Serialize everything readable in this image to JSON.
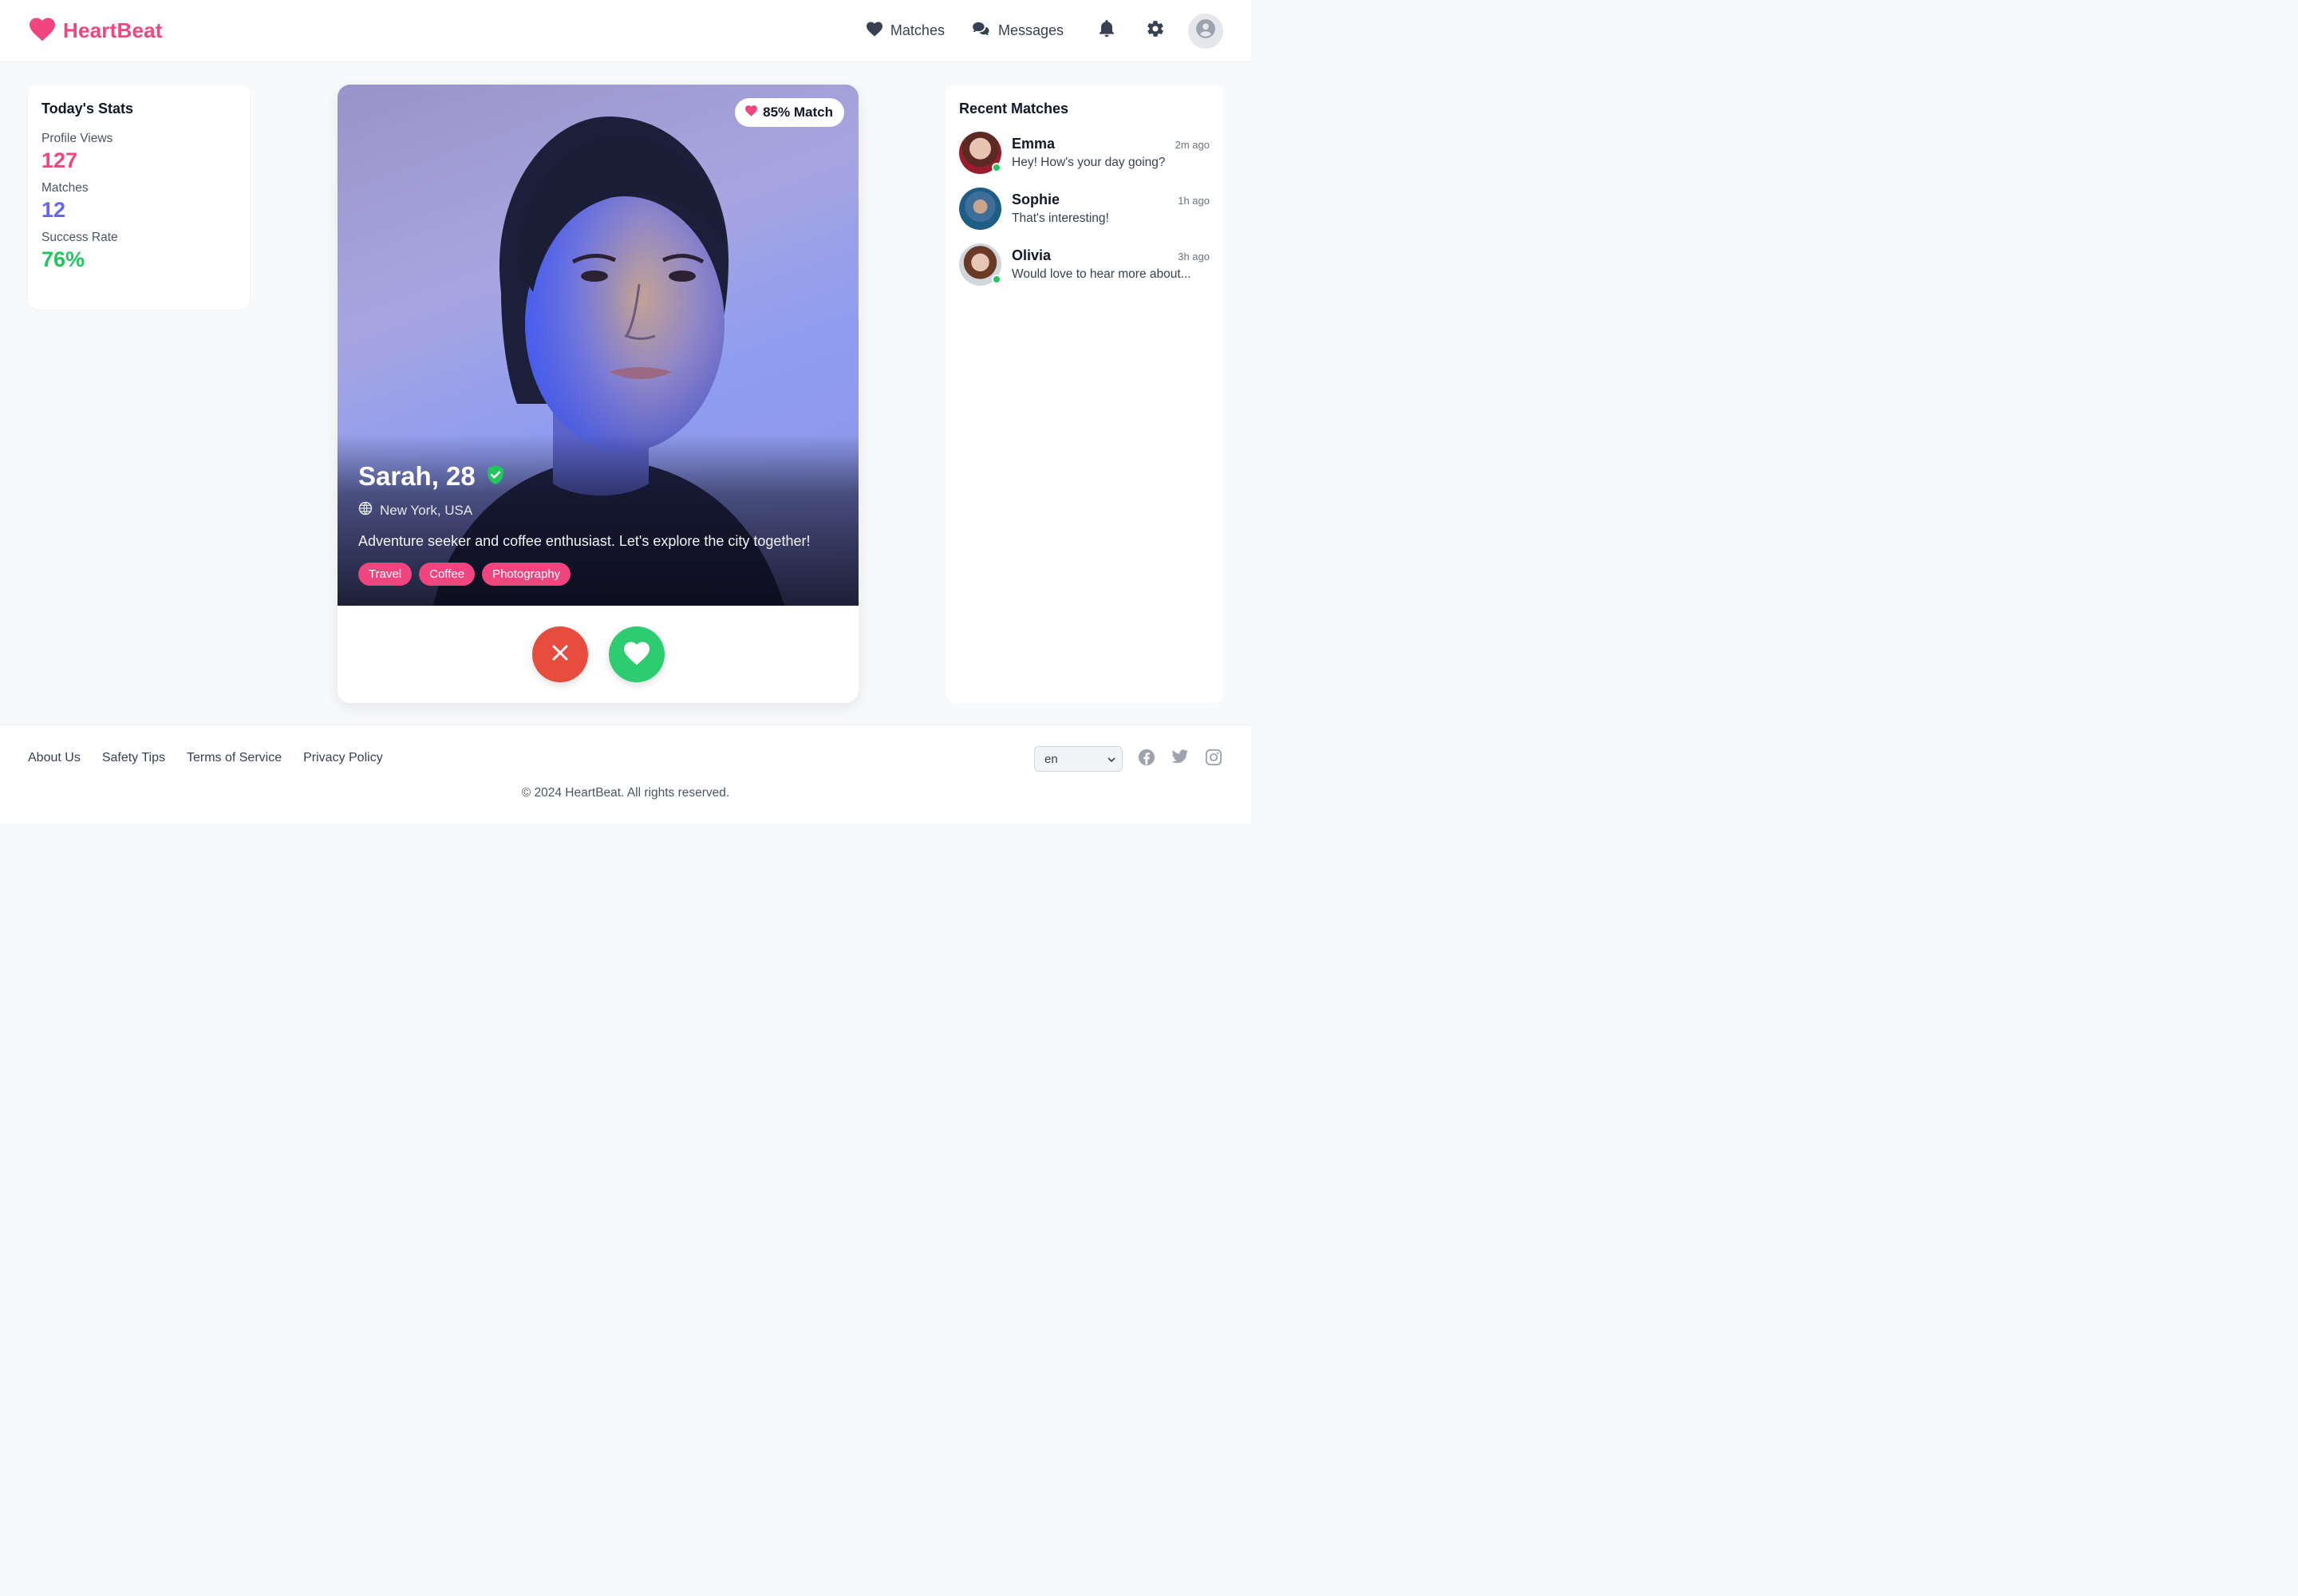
{
  "header": {
    "brand": "HeartBeat",
    "nav": {
      "matches": "Matches",
      "messages": "Messages"
    }
  },
  "stats": {
    "title": "Today's Stats",
    "items": [
      {
        "label": "Profile Views",
        "value": "127",
        "color": "#f0457f"
      },
      {
        "label": "Matches",
        "value": "12",
        "color": "#6366f1"
      },
      {
        "label": "Success Rate",
        "value": "76%",
        "color": "#22c55e"
      }
    ]
  },
  "profile": {
    "match_badge": "85% Match",
    "name": "Sarah, 28",
    "location": "New York, USA",
    "bio": "Adventure seeker and coffee enthusiast. Let's explore the city together!",
    "tags": [
      "Travel",
      "Coffee",
      "Photography"
    ]
  },
  "recent": {
    "title": "Recent Matches",
    "items": [
      {
        "name": "Emma",
        "time": "2m ago",
        "message": "Hey! How's your day going?",
        "online": true
      },
      {
        "name": "Sophie",
        "time": "1h ago",
        "message": "That's interesting!",
        "online": false
      },
      {
        "name": "Olivia",
        "time": "3h ago",
        "message": "Would love to hear more about...",
        "online": true
      }
    ]
  },
  "footer": {
    "links": [
      "About Us",
      "Safety Tips",
      "Terms of Service",
      "Privacy Policy"
    ],
    "language": "en",
    "copyright": "© 2024 HeartBeat. All rights reserved."
  },
  "colors": {
    "brand": "#f0457f",
    "pass": "#e74c3c",
    "like": "#2ecc71"
  }
}
